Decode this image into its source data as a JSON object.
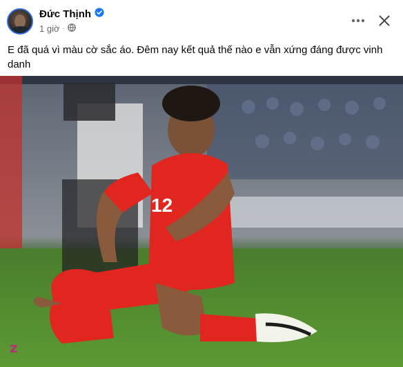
{
  "post": {
    "author": "Đức Thịnh",
    "time": "1 giờ",
    "separator": "·",
    "text": "E đã quá vì màu cờ sắc áo. Đêm nay kết quả thế nào e vẫn xứng đáng được vinh danh",
    "jersey_number": "12",
    "watermark": "z"
  },
  "icons": {
    "verified": "verified-badge-icon",
    "audience": "globe-icon",
    "more": "more-horizontal-icon",
    "close": "close-icon"
  },
  "colors": {
    "verified": "#1877f2",
    "secondary_text": "#65676b",
    "jersey_red": "#e0261f",
    "pitch_green": "#4f8a2a"
  }
}
